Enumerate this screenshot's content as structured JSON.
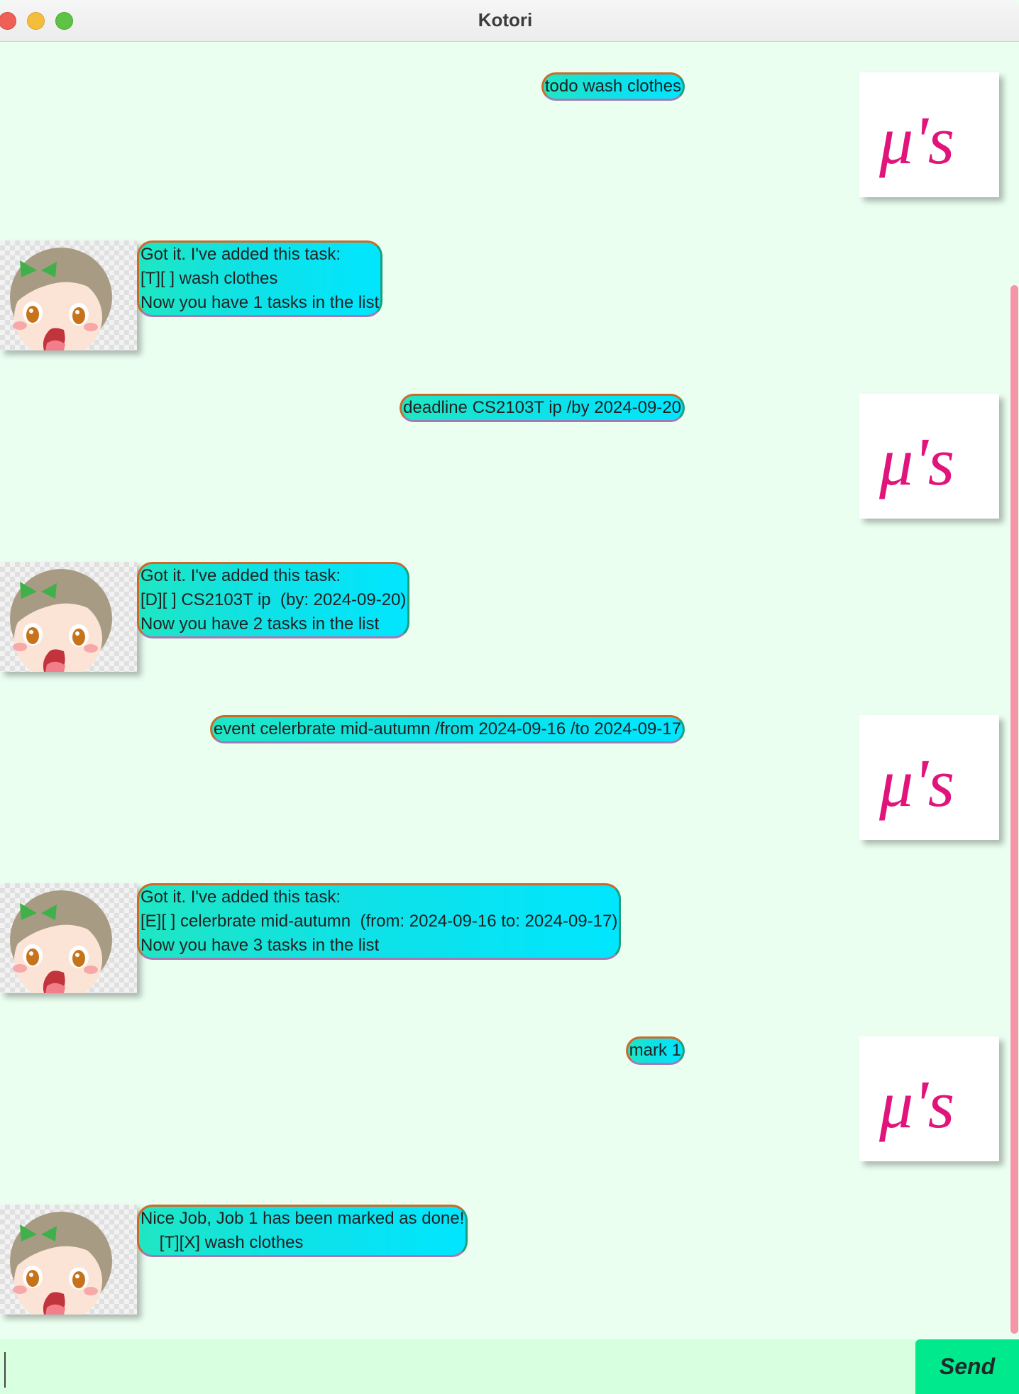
{
  "window": {
    "title": "Kotori"
  },
  "messages": [
    {
      "role": "user",
      "text": "todo wash clothes"
    },
    {
      "role": "bot",
      "text": "Got it. I've added this task:\n[T][ ] wash clothes\nNow you have 1 tasks in the list"
    },
    {
      "role": "user",
      "text": "deadline CS2103T ip /by 2024-09-20"
    },
    {
      "role": "bot",
      "text": "Got it. I've added this task:\n[D][ ] CS2103T ip  (by: 2024-09-20)\nNow you have 2 tasks in the list"
    },
    {
      "role": "user",
      "text": "event celerbrate mid-autumn /from 2024-09-16 /to 2024-09-17"
    },
    {
      "role": "bot",
      "text": "Got it. I've added this task:\n[E][ ] celerbrate mid-autumn  (from: 2024-09-16 to: 2024-09-17)\nNow you have 3 tasks in the list"
    },
    {
      "role": "user",
      "text": "mark 1"
    },
    {
      "role": "bot",
      "text": "Nice Job, Job 1 has been marked as done!\n    [T][X] wash clothes"
    }
  ],
  "user_avatar_text": "μ's",
  "input": {
    "value": "",
    "placeholder": ""
  },
  "send_label": "Send",
  "colors": {
    "accent": "#00e98d",
    "scrollbar": "#f795a8",
    "user_logo": "#e0147a"
  }
}
